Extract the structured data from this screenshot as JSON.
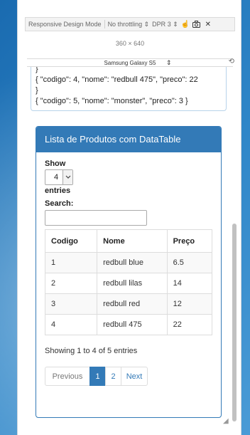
{
  "toolbar": {
    "mode_label": "Responsive Design Mode",
    "throttle_label": "No throttling",
    "throttle_arrow": "⇕",
    "dpr_label": "DPR",
    "dpr_value": "3",
    "dpr_arrow": "⇕"
  },
  "dims": {
    "width": "360",
    "times": "×",
    "height": "640"
  },
  "device": {
    "name": "Samsung Galaxy S5",
    "arrow": "⇕"
  },
  "json_lines": [
    "}",
    "{ \"codigo\": 4, \"nome\": \"redbull 475\", \"preco\": 22",
    "}",
    "{ \"codigo\": 5, \"nome\": \"monster\", \"preco\": 3 }"
  ],
  "panel": {
    "heading": "Lista de Produtos com DataTable",
    "show_label": "Show",
    "length_value": "4",
    "entries_label": "entries",
    "search_label": "Search:",
    "search_value": "",
    "columns": [
      "Codigo",
      "Nome",
      "Preço"
    ],
    "rows": [
      [
        "1",
        "redbull blue",
        "6.5"
      ],
      [
        "2",
        "redbull lilas",
        "14"
      ],
      [
        "3",
        "redbull red",
        "12"
      ],
      [
        "4",
        "redbull 475",
        "22"
      ]
    ],
    "info": "Showing 1 to 4 of 5 entries",
    "pagination": {
      "previous": "Previous",
      "pages": [
        "1",
        "2"
      ],
      "active_page": "1",
      "next": "Next"
    }
  },
  "colors": {
    "primary": "#337ab7",
    "background": "#2f86c8"
  },
  "icons": {
    "touch": "pointer-hand-icon",
    "screenshot": "camera-icon",
    "close": "close-icon",
    "rotate": "rotate-icon",
    "select_chevron": "chevron-down-icon",
    "resize": "resize-grip-icon"
  }
}
